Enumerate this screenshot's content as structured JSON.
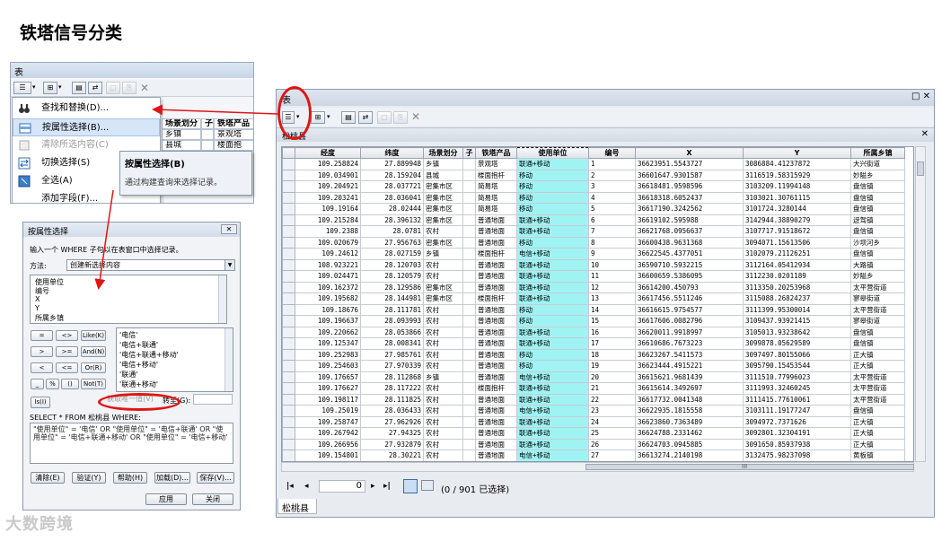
{
  "title": "铁塔信号分类",
  "left_window": {
    "title": "表",
    "menu": [
      {
        "label": "查找和替换(D)...",
        "icon": "binoculars-icon",
        "state": "normal"
      },
      {
        "label": "按属性选择(B)...",
        "icon": "select-by-attributes-icon",
        "state": "highlighted"
      },
      {
        "label": "清除所选内容(C)",
        "icon": "clear-selection-icon",
        "state": "disabled"
      },
      {
        "label": "切换选择(S)",
        "icon": "switch-selection-icon",
        "state": "normal"
      },
      {
        "label": "全选(A)",
        "icon": "select-all-icon",
        "state": "normal"
      },
      {
        "label": "添加字段(F)...",
        "icon": "add-field-icon",
        "state": "normal"
      }
    ],
    "grid_headers": [
      "场景划分",
      "子",
      "铁塔产品"
    ],
    "grid_rows": [
      [
        "乡镇",
        "",
        "景观塔"
      ],
      [
        "县城",
        "",
        "楼面抱"
      ]
    ],
    "tooltip": {
      "title": "按属性选择(B)",
      "description": "通过构建查询来选择记录。"
    }
  },
  "dialog": {
    "title": "按属性选择",
    "close": "✕",
    "instruction": "输入一个 WHERE 子句以在表窗口中选择记录。",
    "method_label": "方法:",
    "method_value": "创建新选择内容",
    "fields": [
      "使用单位",
      "编号",
      "X",
      "Y",
      "所属乡镇"
    ],
    "operators": [
      [
        "=",
        "<>",
        "Like(K)"
      ],
      [
        ">",
        ">=",
        "And(N)"
      ],
      [
        "<",
        "<=",
        "Or(R)"
      ],
      [
        "_",
        "%",
        "()",
        "Not(T)"
      ]
    ],
    "is_button": "Is(I)",
    "values": [
      "'电信'",
      "'电信+联通'",
      "'电信+联通+移动'",
      "'电信+移动'",
      "'联通'",
      "'联通+移动'"
    ],
    "get_unique_values": "获取唯一值(V)",
    "goto_label": "转至(G):",
    "sql_prefix": "SELECT * FROM 松桃县 WHERE:",
    "sql_expression": "\"使用单位\" = '电信' OR \"使用单位\" = '电信+联通' OR \"使用单位\" = '电信+联通+移动' OR \"使用单位\" = '电信+移动'",
    "buttons": [
      "清除(E)",
      "验证(Y)",
      "帮助(H)",
      "加载(D)...",
      "保存(V)..."
    ],
    "footer_buttons": [
      "应用",
      "关闭"
    ]
  },
  "table_window": {
    "title": "表",
    "tab_title": "松桃县",
    "columns": [
      "经度",
      "纬度",
      "场景划分",
      "子",
      "铁塔产品",
      "使用单位",
      "编号",
      "X",
      "Y",
      "所属乡镇"
    ],
    "rows": [
      [
        "109.258824",
        "27.889948",
        "乡镇",
        "",
        "景观塔",
        "联通+移动",
        "1",
        "36623951.5543727",
        "3086884.41237872",
        "大兴街道"
      ],
      [
        "109.034901",
        "28.159204",
        "县城",
        "",
        "楼面抱杆",
        "移动",
        "2",
        "36601647.9301587",
        "3116519.58315929",
        "妙隘乡"
      ],
      [
        "109.204921",
        "28.037721",
        "密集市区",
        "",
        "简易塔",
        "移动",
        "3",
        "36618481.9598596",
        "3103209.11994148",
        "盘信镇"
      ],
      [
        "109.203241",
        "28.036041",
        "密集市区",
        "",
        "简易塔",
        "移动",
        "4",
        "36618318.6052437",
        "3103021.30761115",
        "盘信镇"
      ],
      [
        "109.19164",
        "28.02444",
        "密集市区",
        "",
        "简易塔",
        "移动",
        "5",
        "36617190.3242562",
        "3101724.3280144",
        "盘信镇"
      ],
      [
        "109.215284",
        "28.396132",
        "密集市区",
        "",
        "普通地面",
        "联通+移动",
        "6",
        "36619102.595988",
        "3142944.38890279",
        "迓驾镇"
      ],
      [
        "109.2388",
        "28.0781",
        "农村",
        "",
        "普通地面",
        "联通+移动",
        "7",
        "36621768.0956637",
        "3107717.91518672",
        "盘信镇"
      ],
      [
        "109.020679",
        "27.956763",
        "密集市区",
        "",
        "普通地面",
        "移动",
        "8",
        "36600438.9631368",
        "3094071.15613506",
        "沙坝河乡"
      ],
      [
        "109.24612",
        "28.027159",
        "乡镇",
        "",
        "楼面抱杆",
        "电信+移动",
        "9",
        "36622545.4377051",
        "3102079.21126251",
        "盘信镇"
      ],
      [
        "108.923221",
        "28.120703",
        "农村",
        "",
        "普通地面",
        "联通+移动",
        "10",
        "36590710.5932215",
        "3112164.05412934",
        "大路镇"
      ],
      [
        "109.024471",
        "28.120579",
        "农村",
        "",
        "普通地面",
        "联通+移动",
        "11",
        "36600659.5386095",
        "3112230.0201189",
        "妙隘乡"
      ],
      [
        "109.162372",
        "28.129586",
        "密集市区",
        "",
        "普通地面",
        "联通+移动",
        "12",
        "36614200.450793",
        "3113350.20253968",
        "太平营街道"
      ],
      [
        "109.195682",
        "28.144981",
        "密集市区",
        "",
        "楼面抱杆",
        "联通+移动",
        "13",
        "36617456.5511246",
        "3115088.26824237",
        "寥皋街道"
      ],
      [
        "109.18676",
        "28.111781",
        "农村",
        "",
        "普通地面",
        "移动",
        "14",
        "36616615.9754577",
        "3111399.95300014",
        "太平营街道"
      ],
      [
        "109.196637",
        "28.093993",
        "农村",
        "",
        "普通地面",
        "移动",
        "15",
        "36617606.0082796",
        "3109437.93921415",
        "寥皋街道"
      ],
      [
        "109.220662",
        "28.053866",
        "农村",
        "",
        "普通地面",
        "联通+移动",
        "16",
        "36620011.9918997",
        "3105013.93238642",
        "盘信镇"
      ],
      [
        "109.125347",
        "28.008341",
        "农村",
        "",
        "普通地面",
        "联通+移动",
        "17",
        "36610686.7673223",
        "3099878.05629589",
        "盘信镇"
      ],
      [
        "109.252983",
        "27.985761",
        "农村",
        "",
        "普通地面",
        "移动",
        "18",
        "36623267.5411573",
        "3097497.80155066",
        "正大镇"
      ],
      [
        "109.254603",
        "27.970339",
        "农村",
        "",
        "普通地面",
        "移动",
        "19",
        "36623444.4915221",
        "3095790.15453544",
        "正大镇"
      ],
      [
        "109.176657",
        "28.112868",
        "乡镇",
        "",
        "普通地面",
        "电信+移动",
        "20",
        "36615621.9681439",
        "3111510.77996023",
        "太平营街道"
      ],
      [
        "109.176627",
        "28.117222",
        "农村",
        "",
        "楼面抱杆",
        "联通+移动",
        "21",
        "36615614.3492697",
        "3111993.32460245",
        "太平营街道"
      ],
      [
        "109.198117",
        "28.111825",
        "农村",
        "",
        "普通地面",
        "联通+移动",
        "22",
        "36617732.0041348",
        "3111415.77610061",
        "太平营街道"
      ],
      [
        "109.25019",
        "28.036433",
        "农村",
        "",
        "普通地面",
        "电信+移动",
        "23",
        "36622935.1815558",
        "3103111.19177247",
        "盘信镇"
      ],
      [
        "109.258747",
        "27.962926",
        "农村",
        "",
        "普通地面",
        "联通+移动",
        "24",
        "36623860.7363489",
        "3094972.7371626",
        "正大镇"
      ],
      [
        "109.267942",
        "27.94325",
        "农村",
        "",
        "普通地面",
        "联通+移动",
        "25",
        "36624788.2331462",
        "3092801.32304191",
        "正大镇"
      ],
      [
        "109.266956",
        "27.932879",
        "农村",
        "",
        "普通地面",
        "联通+移动",
        "26",
        "36624703.0945885",
        "3091650.85937938",
        "正大镇"
      ],
      [
        "109.154801",
        "28.30221",
        "农村",
        "",
        "普通地面",
        "电信+移动",
        "27",
        "36613274.2140198",
        "3132475.98237098",
        "黄板镇"
      ]
    ],
    "nav": {
      "record": "0",
      "status": "(0 / 901 已选择)"
    },
    "bottom_tab": "松桃县",
    "hscroll_marker": "III"
  },
  "watermark": "大数跨境",
  "colors": {
    "selected_column": "#9ff3f3",
    "annotation_red": "#e01515"
  }
}
